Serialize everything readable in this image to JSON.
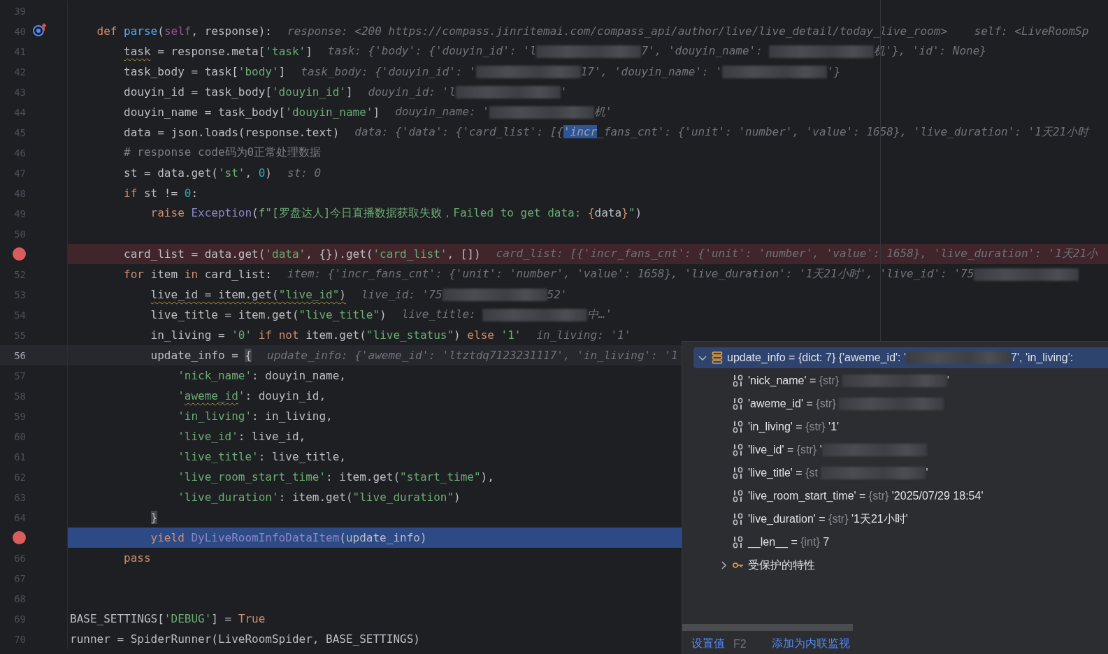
{
  "editor": {
    "class_body": [
      {
        "number": "39",
        "kind": "plain"
      },
      {
        "number": "40",
        "kind": "plain",
        "marker": {
          "kind": "override"
        },
        "code": [
          {
            "kind": "kw",
            "t": "def "
          },
          {
            "kind": "fn",
            "t": "parse"
          },
          {
            "kind": "plain",
            "t": "("
          },
          {
            "kind": "self",
            "t": "self"
          },
          {
            "kind": "plain",
            "t": ", response):"
          }
        ],
        "hint": [
          {
            "kind": "text",
            "t": "response: <200 https://compass.jinritemai.com/compass_api/author/live/live_detail/today_live_room>    self: <LiveRoomSp"
          }
        ],
        "children": [
          {
            "number": "41",
            "kind": "plain",
            "code": [
              {
                "kind": "plain",
                "t": "task",
                "warning": true
              },
              {
                "kind": "plain",
                "t": " = response.meta["
              },
              {
                "kind": "str",
                "t": "'task'"
              },
              {
                "kind": "plain",
                "t": "]"
              }
            ],
            "hint": [
              {
                "kind": "text",
                "t": "task: {'body': {'douyin_id': 'l"
              },
              {
                "kind": "redacted"
              },
              {
                "kind": "text",
                "t": "7', 'douyin_name': "
              },
              {
                "kind": "redacted"
              },
              {
                "kind": "text",
                "t": "机'}, 'id': None}"
              }
            ]
          },
          {
            "number": "42",
            "kind": "plain",
            "code": [
              {
                "kind": "plain",
                "t": "task_body = task["
              },
              {
                "kind": "str",
                "t": "'body'"
              },
              {
                "kind": "plain",
                "t": "]"
              }
            ],
            "hint": [
              {
                "kind": "text",
                "t": "task_body: {'douyin_id': '"
              },
              {
                "kind": "redacted"
              },
              {
                "kind": "text",
                "t": "17', 'douyin_name': '"
              },
              {
                "kind": "redacted"
              },
              {
                "kind": "text",
                "t": "'}"
              }
            ]
          },
          {
            "number": "43",
            "kind": "plain",
            "code": [
              {
                "kind": "plain",
                "t": "douyin_id = task_body["
              },
              {
                "kind": "str",
                "t": "'douyin_id'"
              },
              {
                "kind": "plain",
                "t": "]"
              }
            ],
            "hint": [
              {
                "kind": "text",
                "t": "douyin_id: 'l"
              },
              {
                "kind": "redacted"
              },
              {
                "kind": "text",
                "t": "'"
              }
            ]
          },
          {
            "number": "44",
            "kind": "plain",
            "code": [
              {
                "kind": "plain",
                "t": "douyin_name = task_body["
              },
              {
                "kind": "str",
                "t": "'douyin_name'"
              },
              {
                "kind": "plain",
                "t": "]"
              }
            ],
            "hint": [
              {
                "kind": "text",
                "t": "douyin_name: '"
              },
              {
                "kind": "redacted"
              },
              {
                "kind": "text",
                "t": "机'"
              }
            ]
          },
          {
            "number": "45",
            "kind": "plain",
            "code": [
              {
                "kind": "plain",
                "t": "data = json.loads(response.text)"
              }
            ],
            "hint": [
              {
                "kind": "text",
                "t": "data: {'data': {'card_list': [{"
              },
              {
                "kind": "selected",
                "t": "'incr"
              },
              {
                "kind": "text",
                "t": "_fans_cnt': {'unit': 'number', 'value': 1658}, 'live_duration': '1天21小时"
              }
            ]
          },
          {
            "number": "46",
            "kind": "plain",
            "code": [
              {
                "kind": "comment",
                "t": "# response code码为0正常处理数据"
              }
            ]
          },
          {
            "number": "47",
            "kind": "plain",
            "code": [
              {
                "kind": "plain",
                "t": "st = data.get("
              },
              {
                "kind": "str",
                "t": "'st'"
              },
              {
                "kind": "plain",
                "t": ", "
              },
              {
                "kind": "num",
                "t": "0"
              },
              {
                "kind": "plain",
                "t": ")"
              }
            ],
            "hint": [
              {
                "kind": "text",
                "t": "st: 0"
              }
            ]
          },
          {
            "number": "48",
            "kind": "plain",
            "code": [
              {
                "kind": "kw",
                "t": "if"
              },
              {
                "kind": "plain",
                "t": " st != "
              },
              {
                "kind": "num",
                "t": "0"
              },
              {
                "kind": "plain",
                "t": ":"
              }
            ],
            "children": [
              {
                "number": "49",
                "kind": "plain",
                "code": [
                  {
                    "kind": "kw",
                    "t": "raise "
                  },
                  {
                    "kind": "cls",
                    "t": "Exception"
                  },
                  {
                    "kind": "plain",
                    "t": "("
                  },
                  {
                    "kind": "str",
                    "t": "f\"[罗盘达人]今日直播数据获取失败，Failed to get data: "
                  },
                  {
                    "kind": "fbrace",
                    "t": "{"
                  },
                  {
                    "kind": "plain",
                    "t": "data"
                  },
                  {
                    "kind": "fbrace",
                    "t": "}"
                  },
                  {
                    "kind": "str",
                    "t": "\""
                  },
                  {
                    "kind": "plain",
                    "t": ")"
                  }
                ]
              }
            ]
          },
          {
            "number": "50",
            "kind": "plain"
          },
          {
            "kind": "breakpoint",
            "code": [
              {
                "kind": "plain",
                "t": "card_list = data.get("
              },
              {
                "kind": "str",
                "t": "'data'"
              },
              {
                "kind": "plain",
                "t": ", {}).get("
              },
              {
                "kind": "str",
                "t": "'card_list'"
              },
              {
                "kind": "plain",
                "t": ", [])"
              }
            ],
            "hint": [
              {
                "kind": "text",
                "t": "card_list: [{'incr_fans_cnt': {'unit': 'number', 'value': 1658}, 'live_duration': '1天21小"
              }
            ]
          },
          {
            "number": "52",
            "kind": "plain",
            "code": [
              {
                "kind": "kw",
                "t": "for"
              },
              {
                "kind": "plain",
                "t": " item "
              },
              {
                "kind": "kw",
                "t": "in"
              },
              {
                "kind": "plain",
                "t": " card_list:"
              }
            ],
            "hint": [
              {
                "kind": "text",
                "t": "item: {'incr_fans_cnt': {'unit': 'number', 'value': 1658}, 'live_duration': '1天21小时', 'live_id': '75"
              },
              {
                "kind": "redacted"
              }
            ],
            "children": [
              {
                "number": "53",
                "kind": "plain",
                "code": [
                  {
                    "kind": "plain",
                    "t": "live_id = item.get(",
                    "warning": true
                  },
                  {
                    "kind": "str",
                    "t": "\"live_id\"",
                    "warning": true
                  },
                  {
                    "kind": "plain",
                    "t": ")",
                    "warning": true
                  }
                ],
                "hint": [
                  {
                    "kind": "text",
                    "t": "live_id: '75"
                  },
                  {
                    "kind": "redacted"
                  },
                  {
                    "kind": "text",
                    "t": "52'"
                  }
                ]
              },
              {
                "number": "54",
                "kind": "plain",
                "code": [
                  {
                    "kind": "plain",
                    "t": "live_title = item.get("
                  },
                  {
                    "kind": "str",
                    "t": "\"live_title\""
                  },
                  {
                    "kind": "plain",
                    "t": ")"
                  }
                ],
                "hint": [
                  {
                    "kind": "text",
                    "t": "live_title: "
                  },
                  {
                    "kind": "redacted"
                  },
                  {
                    "kind": "text",
                    "t": "中…'"
                  }
                ]
              },
              {
                "number": "55",
                "kind": "plain",
                "code": [
                  {
                    "kind": "plain",
                    "t": "in_living = "
                  },
                  {
                    "kind": "str",
                    "t": "'0' "
                  },
                  {
                    "kind": "kw",
                    "t": "if "
                  },
                  {
                    "kind": "kw",
                    "t": "not"
                  },
                  {
                    "kind": "plain",
                    "t": " item.get("
                  },
                  {
                    "kind": "str",
                    "t": "\"live_status\""
                  },
                  {
                    "kind": "plain",
                    "t": ") "
                  },
                  {
                    "kind": "kw",
                    "t": "else "
                  },
                  {
                    "kind": "str",
                    "t": "'1'"
                  }
                ],
                "hint": [
                  {
                    "kind": "text",
                    "t": "in_living: '1'"
                  }
                ]
              },
              {
                "number": "56",
                "kind": "current",
                "code": [
                  {
                    "kind": "plain",
                    "t": "update_info = "
                  },
                  {
                    "kind": "match",
                    "t": "{"
                  }
                ],
                "hint": [
                  {
                    "kind": "text",
                    "t": "update_info: {'aweme_id': 'ltztdq7123231117', 'in_living': '1"
                  }
                ],
                "children": [
                  {
                    "number": "57",
                    "kind": "plain",
                    "code": [
                      {
                        "kind": "str",
                        "t": "'nick_name'"
                      },
                      {
                        "kind": "plain",
                        "t": ": douyin_name,"
                      }
                    ]
                  },
                  {
                    "number": "58",
                    "kind": "plain",
                    "code": [
                      {
                        "kind": "str",
                        "t": "'"
                      },
                      {
                        "kind": "str",
                        "t": "aweme_id",
                        "warning": true
                      },
                      {
                        "kind": "str",
                        "t": "'"
                      },
                      {
                        "kind": "plain",
                        "t": ": douyin_id,"
                      }
                    ]
                  },
                  {
                    "number": "59",
                    "kind": "plain",
                    "code": [
                      {
                        "kind": "str",
                        "t": "'in_living'"
                      },
                      {
                        "kind": "plain",
                        "t": ": in_living,"
                      }
                    ]
                  },
                  {
                    "number": "60",
                    "kind": "plain",
                    "code": [
                      {
                        "kind": "str",
                        "t": "'live_id'"
                      },
                      {
                        "kind": "plain",
                        "t": ": live_id,"
                      }
                    ]
                  },
                  {
                    "number": "61",
                    "kind": "plain",
                    "code": [
                      {
                        "kind": "str",
                        "t": "'live_title'"
                      },
                      {
                        "kind": "plain",
                        "t": ": live_title,"
                      }
                    ]
                  },
                  {
                    "number": "62",
                    "kind": "plain",
                    "code": [
                      {
                        "kind": "str",
                        "t": "'live_room_start_time'"
                      },
                      {
                        "kind": "plain",
                        "t": ": item.get("
                      },
                      {
                        "kind": "str",
                        "t": "\"start_time\""
                      },
                      {
                        "kind": "plain",
                        "t": "),"
                      }
                    ]
                  },
                  {
                    "number": "63",
                    "kind": "plain",
                    "code": [
                      {
                        "kind": "str",
                        "t": "'live_duration'"
                      },
                      {
                        "kind": "plain",
                        "t": ": item.get("
                      },
                      {
                        "kind": "str",
                        "t": "\"live_duration\""
                      },
                      {
                        "kind": "plain",
                        "t": ")"
                      }
                    ]
                  }
                ]
              },
              {
                "number": "64",
                "kind": "plain",
                "code": [
                  {
                    "kind": "match",
                    "t": "}"
                  }
                ]
              },
              {
                "kind": "execution",
                "code": [
                  {
                    "kind": "kw",
                    "t": "yield "
                  },
                  {
                    "kind": "cls",
                    "t": "DyLiveRoomInfoDataItem"
                  },
                  {
                    "kind": "plain",
                    "t": "(update_info)"
                  }
                ]
              }
            ]
          },
          {
            "number": "66",
            "kind": "plain",
            "code": [
              {
                "kind": "kw",
                "t": "pass"
              }
            ]
          }
        ]
      },
      {
        "number": "67",
        "kind": "plain"
      },
      {
        "number": "68",
        "kind": "plain"
      }
    ],
    "lines": [
      {
        "number": "69",
        "kind": "plain",
        "code": [
          {
            "kind": "plain",
            "t": "BASE_SETTINGS["
          },
          {
            "kind": "str",
            "t": "'DEBUG'"
          },
          {
            "kind": "plain",
            "t": "] = "
          },
          {
            "kind": "kw",
            "t": "True"
          }
        ]
      },
      {
        "number": "70",
        "kind": "plain",
        "code": [
          {
            "kind": "plain",
            "t": "runner = SpiderRunner(LiveRoomSpider, BASE_SETTINGS)"
          }
        ]
      }
    ]
  },
  "variables_popup": {
    "items": [
      {
        "kind": "dict",
        "name": "update_info =",
        "type": "{dict: 7}",
        "value": [
          {
            "kind": "text",
            "t": "{'aweme_id': '"
          },
          {
            "kind": "redacted"
          },
          {
            "kind": "text",
            "t": "7', 'in_living':"
          }
        ],
        "expanded": true,
        "selected": true,
        "children": [
          {
            "kind": "field",
            "name": "'nick_name' =",
            "type": "{str}",
            "value": [
              {
                "kind": "redacted"
              },
              {
                "kind": "text",
                "t": "'"
              }
            ],
            "selected": false
          },
          {
            "kind": "field",
            "name": "'aweme_id' =",
            "type": "{str}",
            "value": [
              {
                "kind": "redacted"
              }
            ],
            "selected": false
          },
          {
            "kind": "field",
            "name": "'in_living' =",
            "type": "{str}",
            "value": [
              {
                "kind": "text",
                "t": "'1'"
              }
            ],
            "selected": false
          },
          {
            "kind": "field",
            "name": "'live_id' =",
            "type": "{str}",
            "value": [
              {
                "kind": "text",
                "t": "'"
              },
              {
                "kind": "redacted"
              }
            ],
            "selected": false
          },
          {
            "kind": "field",
            "name": "'live_title' =",
            "type": "{st",
            "value": [
              {
                "kind": "redacted"
              },
              {
                "kind": "text",
                "t": "'"
              }
            ],
            "selected": false
          },
          {
            "kind": "field",
            "name": "'live_room_start_time' =",
            "type": "{str}",
            "value": [
              {
                "kind": "text",
                "t": "'2025/07/29 18:54'"
              }
            ],
            "selected": false
          },
          {
            "kind": "field",
            "name": "'live_duration' =",
            "type": "{str}",
            "value": [
              {
                "kind": "text",
                "t": "'1天21小时'"
              }
            ],
            "selected": false
          },
          {
            "kind": "field",
            "name": "__len__ =",
            "type": "{int}",
            "value": [
              {
                "kind": "text",
                "t": "7"
              }
            ],
            "selected": false
          },
          {
            "kind": "group",
            "name": "受保护的特性",
            "expanded": false,
            "selected": false
          }
        ]
      }
    ],
    "actions": [
      {
        "label": "设置值",
        "shortcut": "F2"
      },
      {
        "label": "添加为内联监视"
      }
    ]
  }
}
